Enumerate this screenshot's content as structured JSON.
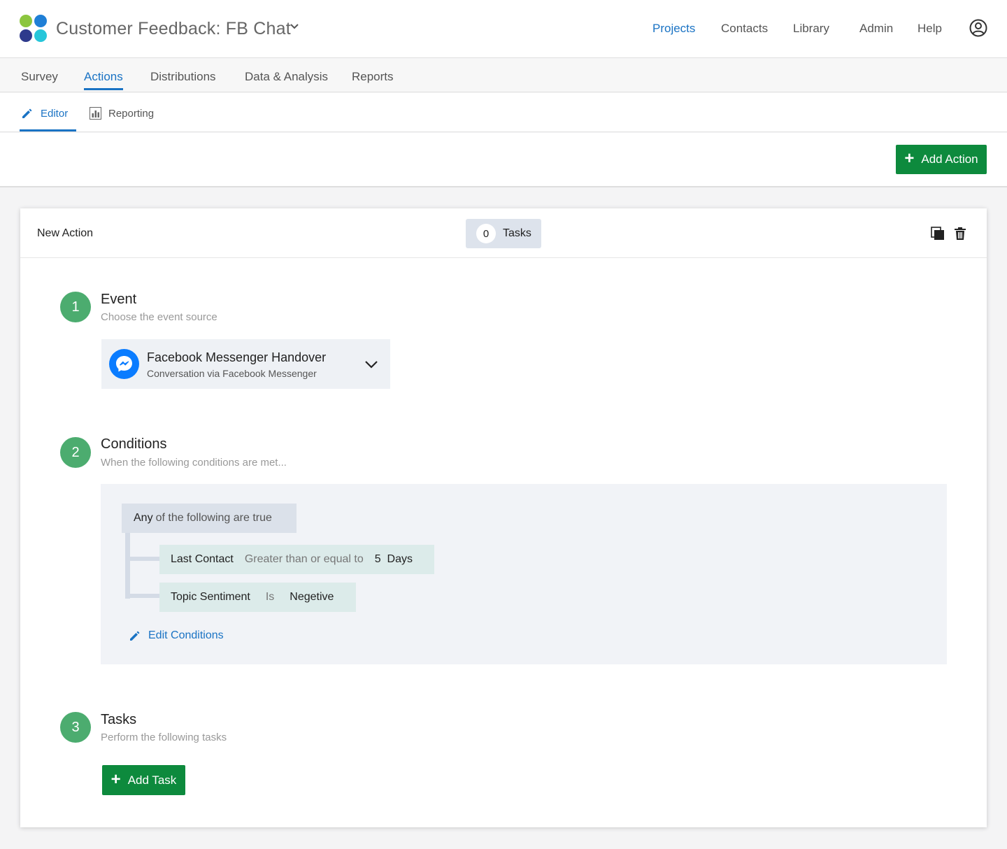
{
  "header": {
    "project_title": "Customer Feedback: FB Chat",
    "nav": [
      "Projects",
      "Contacts",
      "Library",
      "Admin",
      "Help"
    ],
    "active_nav": "Projects"
  },
  "tabs": [
    "Survey",
    "Actions",
    "Distributions",
    "Data & Analysis",
    "Reports"
  ],
  "active_tab": "Actions",
  "subtabs": {
    "editor": "Editor",
    "reporting": "Reporting",
    "active": "Editor"
  },
  "toolbar": {
    "add_action_label": "Add Action"
  },
  "action": {
    "title": "New Action",
    "tasks_count": "0",
    "tasks_label": "Tasks"
  },
  "steps": {
    "event": {
      "number": "1",
      "title": "Event",
      "subtitle": "Choose the event source",
      "selected_title": "Facebook Messenger Handover",
      "selected_sub": "Conversation via Facebook Messenger"
    },
    "conditions": {
      "number": "2",
      "title": "Conditions",
      "subtitle": "When the following conditions are met...",
      "group_any": "Any",
      "group_rest": "of the following are true",
      "rows": [
        {
          "field": "Last Contact",
          "operator": "Greater than or equal to",
          "value": "5  Days"
        },
        {
          "field": "Topic Sentiment",
          "operator": "Is",
          "value": "Negetive"
        }
      ],
      "edit_label": "Edit Conditions"
    },
    "tasks": {
      "number": "3",
      "title": "Tasks",
      "subtitle": "Perform the following tasks",
      "add_task_label": "Add Task"
    }
  },
  "colors": {
    "accent": "#1a73c4",
    "primary_button": "#0d8a3d",
    "step_badge": "#4cac6f",
    "messenger": "#0a7cff"
  }
}
